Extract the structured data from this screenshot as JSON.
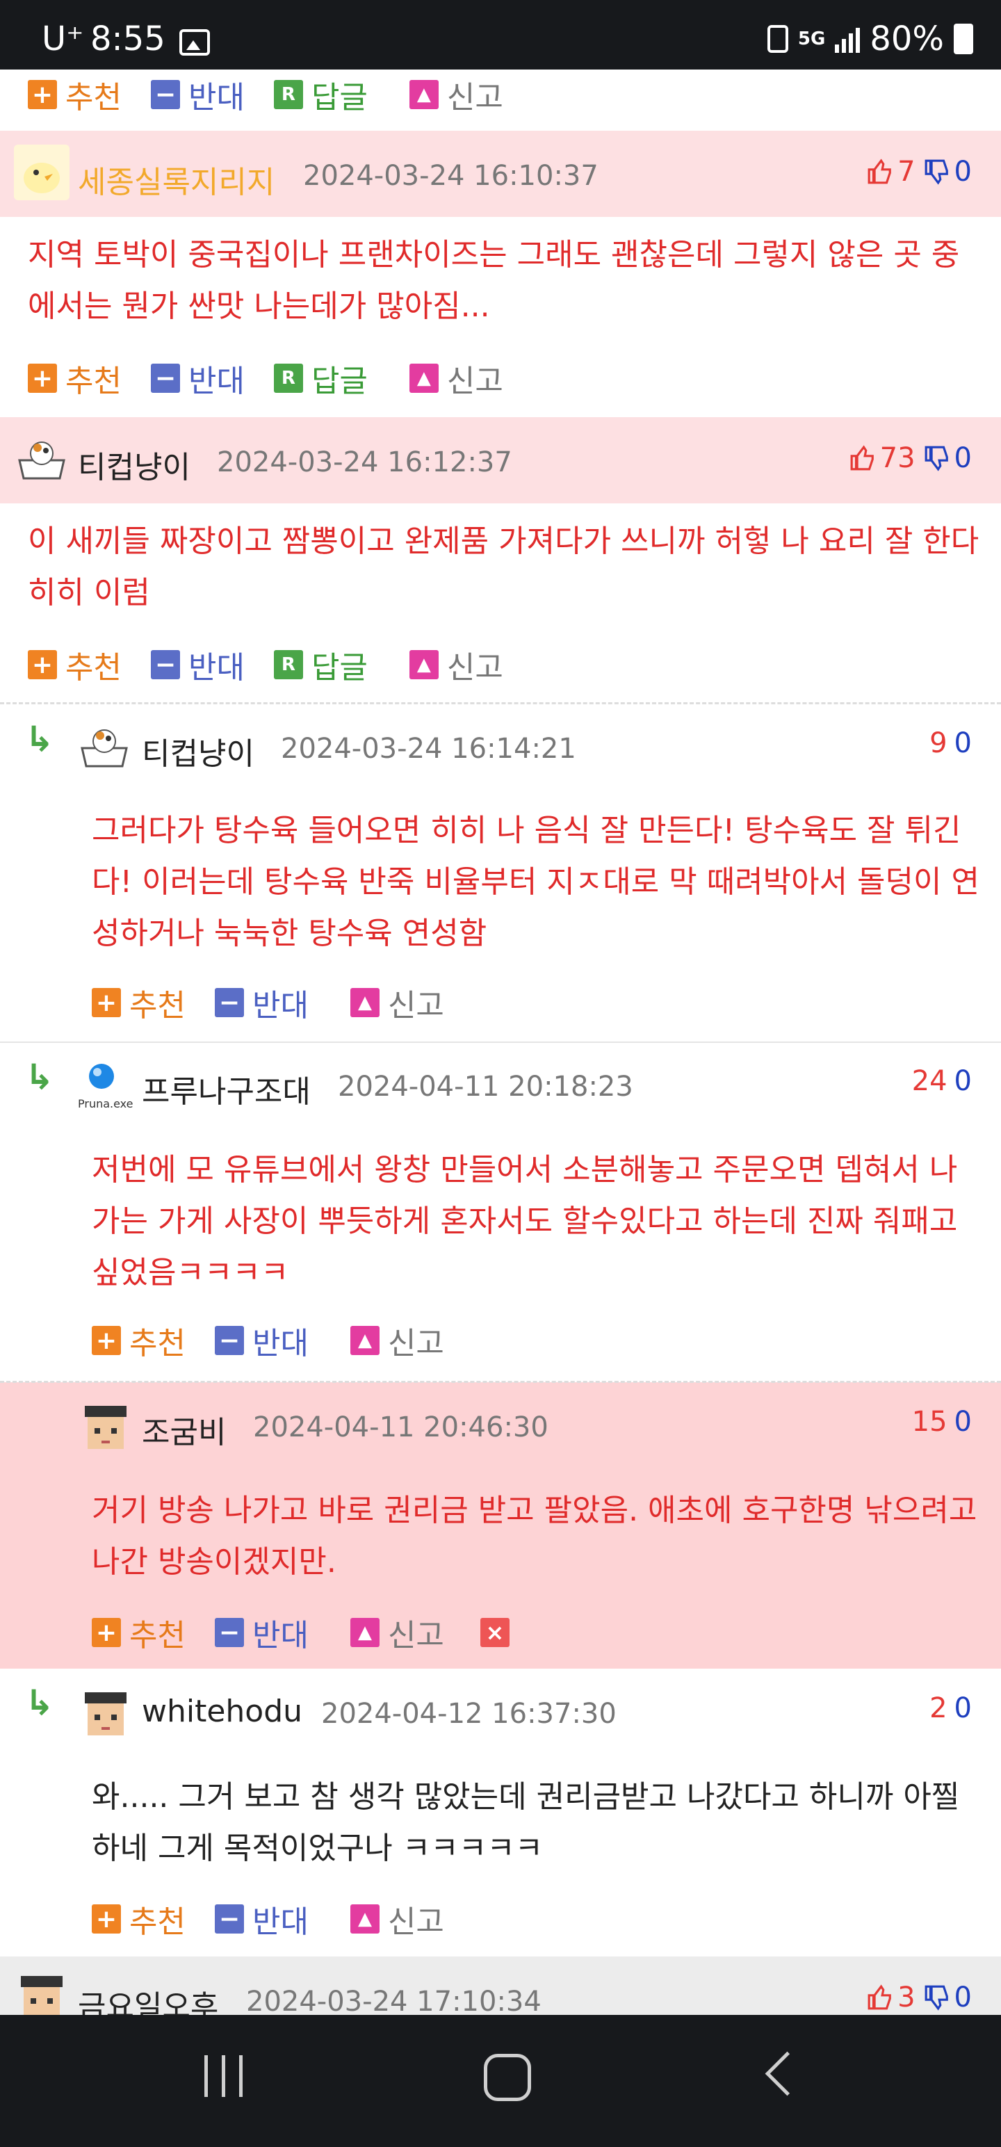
{
  "status": {
    "carrier": "U⁺",
    "time": "8:55",
    "network": "5G",
    "battery": "80%"
  },
  "actions": {
    "recommend": "추천",
    "oppose": "반대",
    "reply": "답글",
    "report": "신고"
  },
  "comments": [
    {
      "nick": "세종실록지리지",
      "date": "2024-03-24 16:10:37",
      "up": "7",
      "down": "0",
      "text": "지역 토박이 중국집이나 프랜차이즈는 그래도 괜찮은데 그렇지 않은 곳 중에서는 뭔가 싼맛 나는데가 많아짐..."
    },
    {
      "nick": "티컵냥이",
      "date": "2024-03-24 16:12:37",
      "up": "73",
      "down": "0",
      "text": "이 새끼들 짜장이고 짬뽕이고 완제품 가져다가 쓰니까 허헣 나 요리 잘 한다 히히 이럼"
    },
    {
      "nick": "티컵냥이",
      "date": "2024-03-24 16:14:21",
      "up": "9",
      "down": "0",
      "text": "그러다가 탕수육 들어오면 히히 나 음식 잘 만든다! 탕수육도 잘 튀긴다! 이러는데 탕수육 반죽 비율부터 지ㅈ대로 막 때려박아서 돌덩이 연성하거나 눅눅한 탕수육 연성함"
    },
    {
      "nick": "프루나구조대",
      "avatar_caption": "Pruna.exe",
      "date": "2024-04-11 20:18:23",
      "up": "24",
      "down": "0",
      "text": "저번에 모 유튜브에서 왕창 만들어서 소분해놓고 주문오면 뎁혀서 나가는 가게 사장이 뿌듯하게 혼자서도 할수있다고 하는데 진짜 줘패고 싶었음ㅋㅋㅋㅋ"
    },
    {
      "nick": "조굼비",
      "date": "2024-04-11 20:46:30",
      "up": "15",
      "down": "0",
      "text": "거기 방송 나가고 바로 권리금 받고 팔았음. 애초에 호구한명 낚으려고 나간 방송이겠지만."
    },
    {
      "nick": "whitehodu",
      "date": "2024-04-12 16:37:30",
      "up": "2",
      "down": "0",
      "text": "와..... 그거 보고 참 생각 많았는데 권리금받고 나갔다고 하니까 아찔하네 그게 목적이었구나 ㅋㅋㅋㅋㅋ"
    },
    {
      "nick": "금요일오후",
      "date": "2024-03-24 17:10:34",
      "up": "3",
      "down": "0"
    }
  ]
}
